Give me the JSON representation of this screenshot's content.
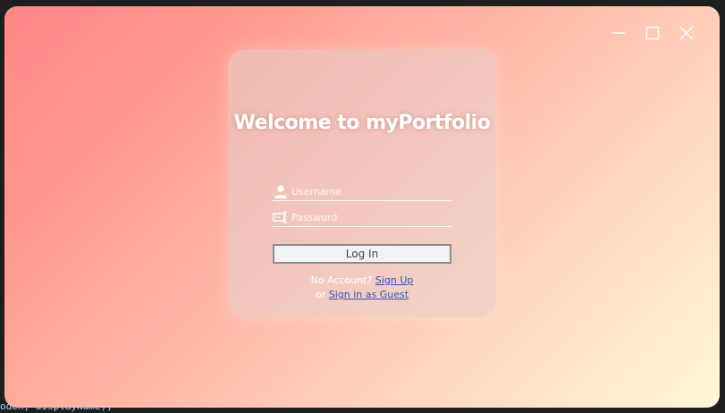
{
  "window": {
    "controls": {
      "minimize_icon": "minimize-icon",
      "maximize_icon": "maximize-icon",
      "close_icon": "close-icon"
    }
  },
  "background_code": {
    "fragment_bottom": "oden, displayName);"
  },
  "login": {
    "title": "Welcome to myPortfolio",
    "username_placeholder": "Username",
    "password_placeholder": "Password",
    "login_button": "Log In",
    "no_account_text": "No Account?",
    "sign_up_link": "Sign Up",
    "or_text": "or",
    "guest_link": "Sign in as Guest"
  },
  "colors": {
    "gradient_start": "#ff8585",
    "gradient_end": "#fff7d6",
    "link": "#2a56c6"
  }
}
